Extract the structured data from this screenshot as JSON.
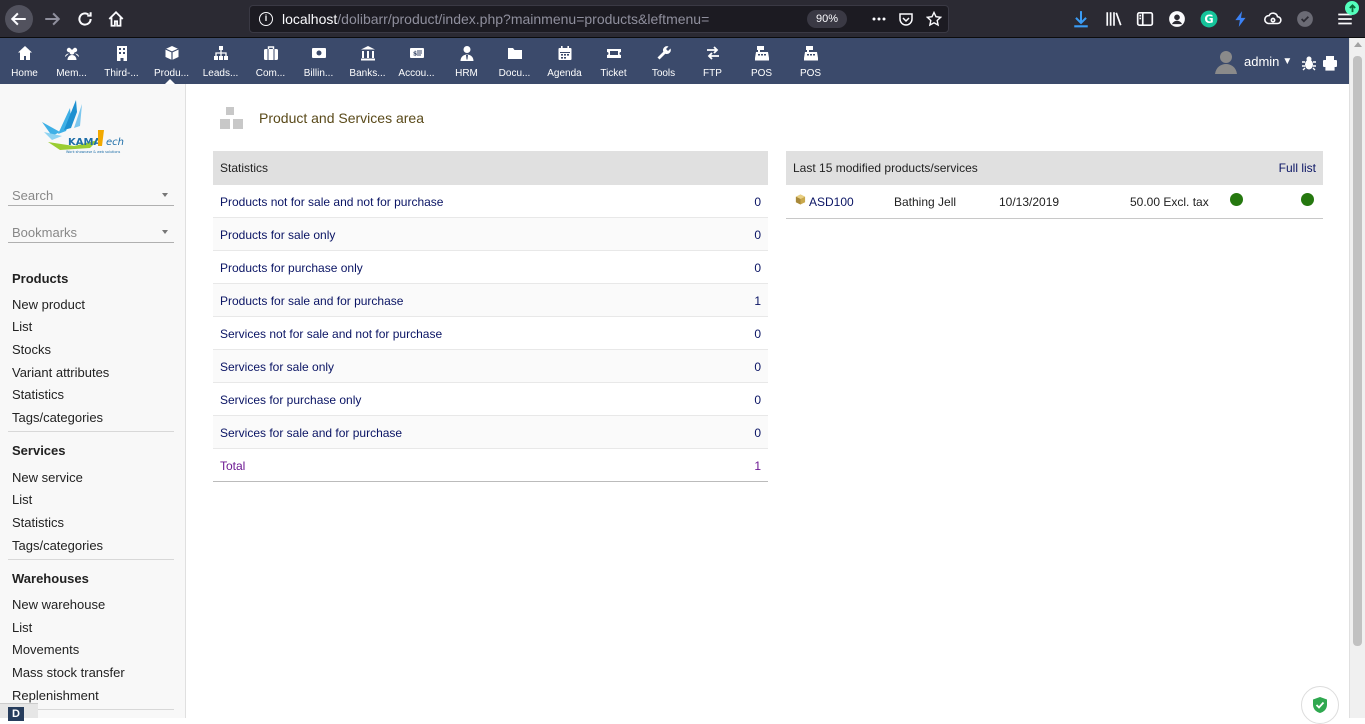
{
  "browser": {
    "url_host": "localhost",
    "url_path": "/dolibarr/product/index.php?mainmenu=products&leftmenu=",
    "zoom": "90%"
  },
  "topmenu": {
    "items": [
      {
        "label": "Home",
        "icon": "home-icon"
      },
      {
        "label": "Mem...",
        "icon": "members-icon"
      },
      {
        "label": "Third-...",
        "icon": "building-icon"
      },
      {
        "label": "Produ...",
        "icon": "cube-icon"
      },
      {
        "label": "Leads...",
        "icon": "sitemap-icon"
      },
      {
        "label": "Com...",
        "icon": "briefcase-icon"
      },
      {
        "label": "Billin...",
        "icon": "money-icon"
      },
      {
        "label": "Banks...",
        "icon": "bank-icon"
      },
      {
        "label": "Accou...",
        "icon": "ledger-icon"
      },
      {
        "label": "HRM",
        "icon": "user-tie-icon"
      },
      {
        "label": "Docu...",
        "icon": "folder-icon"
      },
      {
        "label": "Agenda",
        "icon": "calendar-icon"
      },
      {
        "label": "Ticket",
        "icon": "ticket-icon"
      },
      {
        "label": "Tools",
        "icon": "wrench-icon"
      },
      {
        "label": "FTP",
        "icon": "exchange-icon"
      },
      {
        "label": "POS",
        "icon": "cash-register-icon"
      },
      {
        "label": "POS",
        "icon": "cash-register-icon"
      }
    ],
    "user_name": "admin"
  },
  "sidebar": {
    "search_placeholder": "Search",
    "bookmarks_placeholder": "Bookmarks",
    "products": {
      "title": "Products",
      "links": [
        "New product",
        "List",
        "Stocks",
        "Variant attributes",
        "Statistics",
        "Tags/categories"
      ]
    },
    "services": {
      "title": "Services",
      "links": [
        "New service",
        "List",
        "Statistics",
        "Tags/categories"
      ]
    },
    "warehouses": {
      "title": "Warehouses",
      "links": [
        "New warehouse",
        "List",
        "Movements",
        "Mass stock transfer",
        "Replenishment"
      ]
    }
  },
  "main": {
    "title": "Product and Services area",
    "statistics": {
      "header": "Statistics",
      "rows": [
        {
          "label": "Products not for sale and not for purchase",
          "value": "0"
        },
        {
          "label": "Products for sale only",
          "value": "0"
        },
        {
          "label": "Products for purchase only",
          "value": "0"
        },
        {
          "label": "Products for sale and for purchase",
          "value": "1"
        },
        {
          "label": "Services not for sale and not for purchase",
          "value": "0"
        },
        {
          "label": "Services for sale only",
          "value": "0"
        },
        {
          "label": "Services for purchase only",
          "value": "0"
        },
        {
          "label": "Services for sale and for purchase",
          "value": "0"
        }
      ],
      "total_label": "Total",
      "total_value": "1"
    },
    "recent": {
      "header": "Last 15 modified products/services",
      "full_list_label": "Full list",
      "rows": [
        {
          "ref": "ASD100",
          "name": "Bathing Jell",
          "date": "10/13/2019",
          "price": "50.00 Excl. tax",
          "status_sell_color": "#25780f",
          "status_buy_color": "#25780f"
        }
      ]
    }
  },
  "colors": {
    "menu_bg": "#3b4a6b",
    "link": "#0a1464",
    "status_on": "#25780f"
  }
}
